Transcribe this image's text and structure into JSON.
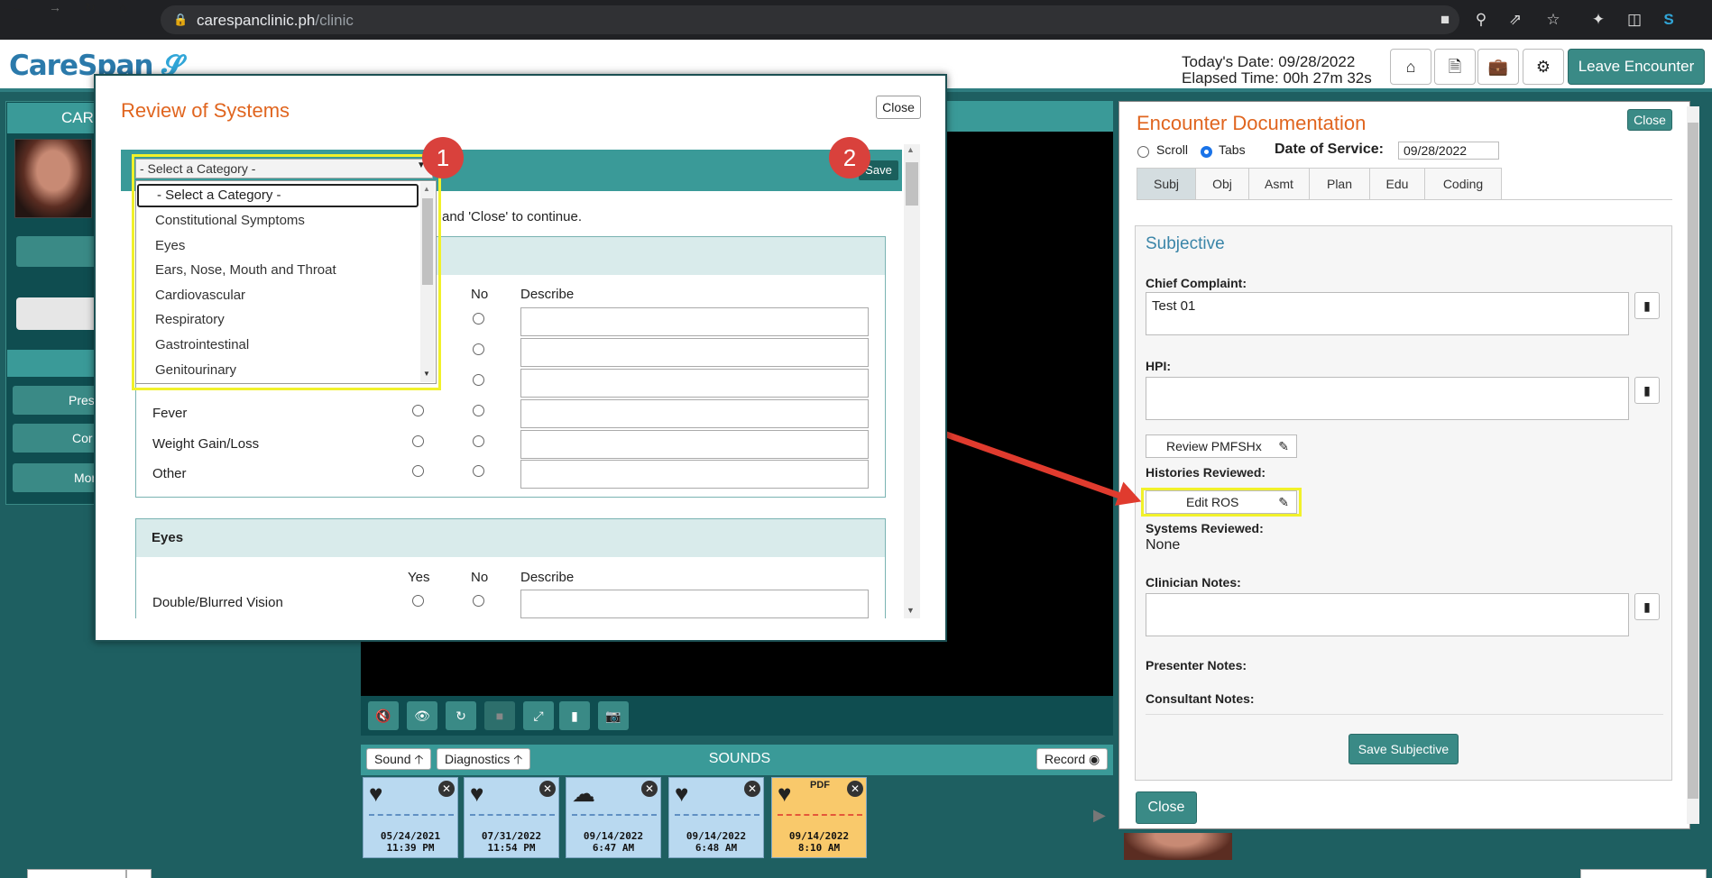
{
  "browser": {
    "url_host": "carespanclinic.ph",
    "url_path": "/clinic",
    "icons": [
      "back-icon",
      "forward-icon",
      "reload-icon",
      "home-icon",
      "lock-icon",
      "camera-icon",
      "zoom-icon",
      "share-icon",
      "star-icon",
      "extensions-icon",
      "sidepanel-icon",
      "profile-icon"
    ]
  },
  "app": {
    "logo_text": "CareSpan",
    "today_date": "Today's Date: 09/28/2022",
    "elapsed_time": "Elapsed Time: 00h 27m 32s",
    "leave_label": "Leave Encounter",
    "left_title": "CAR",
    "left_buttons": [
      "Pres",
      "Cor",
      "Mor"
    ],
    "sounds": {
      "sound_label": "Sound",
      "diagnostics_label": "Diagnostics",
      "title": "SOUNDS",
      "record_label": "Record",
      "items": [
        {
          "type": "heart",
          "date": "05/24/2021",
          "time": "11:39 PM"
        },
        {
          "type": "heart",
          "date": "07/31/2022",
          "time": "11:54 PM"
        },
        {
          "type": "ear",
          "date": "09/14/2022",
          "time": "6:47 AM"
        },
        {
          "type": "heart",
          "date": "09/14/2022",
          "time": "6:48 AM"
        },
        {
          "type": "pdf",
          "label": "PDF",
          "date": "09/14/2022",
          "time": "8:10 AM"
        }
      ]
    }
  },
  "ros": {
    "title": "Review of Systems",
    "close_label": "Close",
    "save_label": "Save",
    "select_value": "- Select a Category -",
    "instruction": "and 'Close' to continue.",
    "dropdown_options": [
      "- Select a Category -",
      "Constitutional Symptoms",
      "Eyes",
      "Ears, Nose, Mouth and Throat",
      "Cardiovascular",
      "Respiratory",
      "Gastrointestinal",
      "Genitourinary"
    ],
    "col_yes": "Yes",
    "col_no": "No",
    "col_describe": "Describe",
    "constitutional_rows": [
      "Fever",
      "Weight Gain/Loss",
      "Other"
    ],
    "eyes_title": "Eyes",
    "eyes_rows": [
      "Double/Blurred Vision"
    ],
    "badge1": "1",
    "badge2": "2"
  },
  "encounter": {
    "title": "Encounter Documentation",
    "close_label": "Close",
    "view_scroll": "Scroll",
    "view_tabs": "Tabs",
    "date_of_service_label": "Date of Service:",
    "date_of_service_value": "09/28/2022",
    "tabs": [
      "Subj",
      "Obj",
      "Asmt",
      "Plan",
      "Edu",
      "Coding"
    ],
    "subjective_title": "Subjective",
    "chief_complaint_label": "Chief Complaint:",
    "chief_complaint_value": "Test 01",
    "hpi_label": "HPI:",
    "review_pmfshx": "Review PMFSHx",
    "histories_reviewed_label": "Histories Reviewed:",
    "edit_ros": "Edit ROS",
    "systems_reviewed_label": "Systems Reviewed:",
    "systems_reviewed_value": "None",
    "clinician_notes_label": "Clinician Notes:",
    "presenter_notes_label": "Presenter Notes:",
    "consultant_notes_label": "Consultant Notes:",
    "save_subjective": "Save Subjective",
    "bottom_close": "Close"
  },
  "colors": {
    "teal": "#3a9a98",
    "dark_teal": "#1e5f61",
    "orange_title": "#e0651f",
    "highlight_yellow": "#f1f12a",
    "badge_red": "#d9413c"
  }
}
